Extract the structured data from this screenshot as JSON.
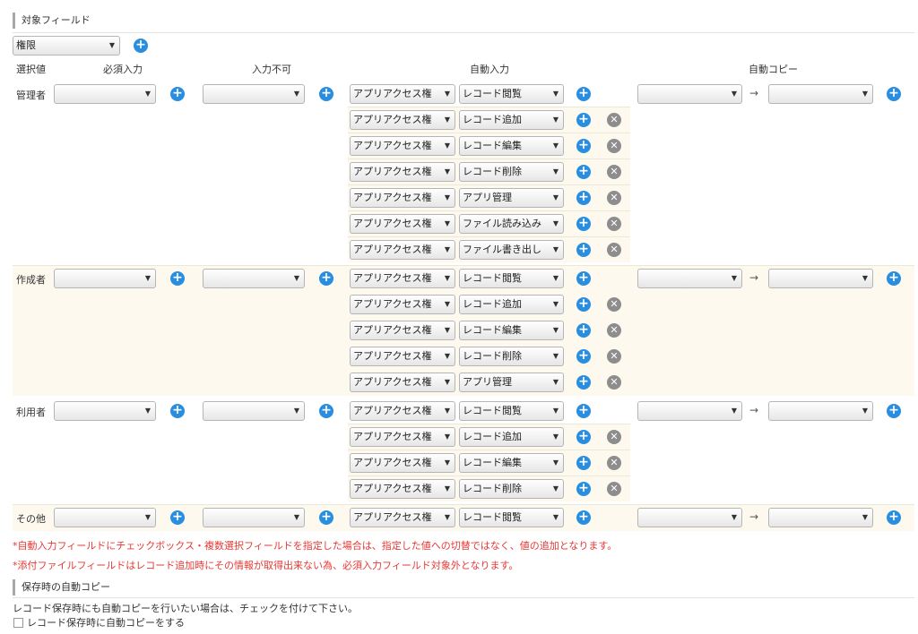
{
  "section_target": "対象フィールド",
  "field_select": "権限",
  "headers": {
    "select_value": "選択値",
    "required": "必須入力",
    "readonly": "入力不可",
    "auto_input": "自動入力",
    "auto_copy": "自動コピー"
  },
  "auto_field": "アプリアクセス権",
  "perms": [
    "レコード閲覧",
    "レコード追加",
    "レコード編集",
    "レコード削除",
    "アプリ管理",
    "ファイル読み込み",
    "ファイル書き出し"
  ],
  "roles": [
    {
      "label": "管理者",
      "perm_count": 7
    },
    {
      "label": "作成者",
      "perm_count": 5
    },
    {
      "label": "利用者",
      "perm_count": 4
    },
    {
      "label": "その他",
      "perm_count": 1
    }
  ],
  "arrow": "→",
  "notes": [
    "*自動入力フィールドにチェックボックス・複数選択フィールドを指定した場合は、指定した値への切替ではなく、値の追加となります。",
    "*添付ファイルフィールドはレコード追加時にその情報が取得出来ない為、必須入力フィールド対象外となります。"
  ],
  "section_save": "保存時の自動コピー",
  "save_desc": "レコード保存時にも自動コピーを行いたい場合は、チェックを付けて下さい。",
  "save_checkbox_label": "レコード保存時に自動コピーをする",
  "save_checkbox_checked": false
}
